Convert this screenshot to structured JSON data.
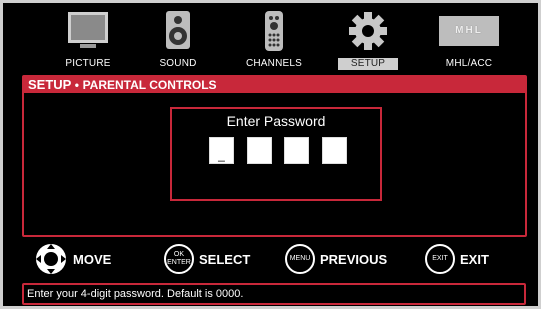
{
  "nav": {
    "items": [
      {
        "label": "PICTURE",
        "icon": "tv-icon",
        "active": false
      },
      {
        "label": "SOUND",
        "icon": "speaker-icon",
        "active": false
      },
      {
        "label": "CHANNELS",
        "icon": "remote-icon",
        "active": false
      },
      {
        "label": "SETUP",
        "icon": "gear-icon",
        "active": true
      },
      {
        "label": "MHL/ACC",
        "icon": "mhl-logo-icon",
        "active": false
      }
    ],
    "mhl_logo_text": "MHL"
  },
  "panel": {
    "title": "SETUP",
    "separator": "•",
    "subtitle": "PARENTAL CONTROLS",
    "password": {
      "title": "Enter Password",
      "digits": [
        "_",
        "",
        "",
        ""
      ]
    }
  },
  "controls": {
    "move": {
      "label": "MOVE"
    },
    "select": {
      "label": "SELECT",
      "button_top": "OK",
      "button_bottom": "ENTER"
    },
    "previous": {
      "label": "PREVIOUS",
      "button": "MENU"
    },
    "exit": {
      "label": "EXIT",
      "button": "EXIT"
    }
  },
  "status": {
    "text": "Enter your 4-digit password. Default is 0000."
  },
  "colors": {
    "accent": "#c8283a",
    "background": "#000000",
    "active_tab": "#cfcfcf"
  }
}
